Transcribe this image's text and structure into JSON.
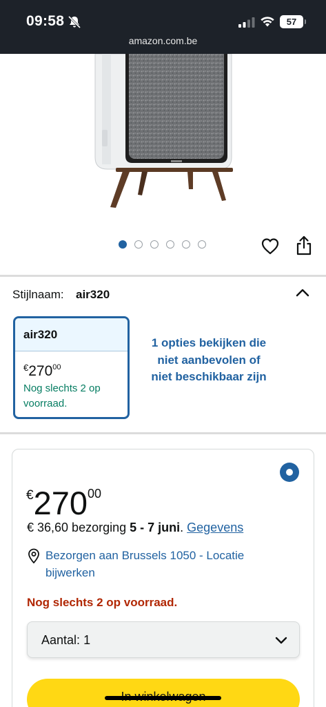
{
  "status_bar": {
    "time": "09:58",
    "battery": "57",
    "url": "amazon.com.be",
    "icons": [
      "bell-slash-icon",
      "signal-icon",
      "wifi-icon",
      "battery-icon"
    ]
  },
  "gallery": {
    "dot_count": 6,
    "active_dot": 0,
    "icons": [
      "heart-icon",
      "share-icon"
    ]
  },
  "style": {
    "label": "Stijlnaam:",
    "value": "air320",
    "card": {
      "name": "air320",
      "currency": "€",
      "price_whole": "270",
      "price_fraction": "00",
      "stock": "Nog slechts 2 op voorraad."
    },
    "more_options": "1 opties bekijken die niet aanbevolen of niet beschikbaar zijn"
  },
  "buybox": {
    "currency": "€",
    "price_whole": "270",
    "price_fraction": "00",
    "delivery_prefix": "€ 36,60 bezorging ",
    "delivery_dates": "5 - 7 juni",
    "delivery_sep": ". ",
    "delivery_link": "Gegevens",
    "location": "Bezorgen aan Brussels 1050 - Locatie bijwerken",
    "stock_warning": "Nog slechts 2 op voorraad.",
    "quantity_label": "Aantal:",
    "quantity_value": "1",
    "cart_button": "In winkelwagen"
  },
  "colors": {
    "status_bar_bg": "#1d2229",
    "link_blue": "#2162a1",
    "in_stock_green": "#067d62",
    "warning_red": "#b12704",
    "cart_yellow": "#ffd814"
  }
}
